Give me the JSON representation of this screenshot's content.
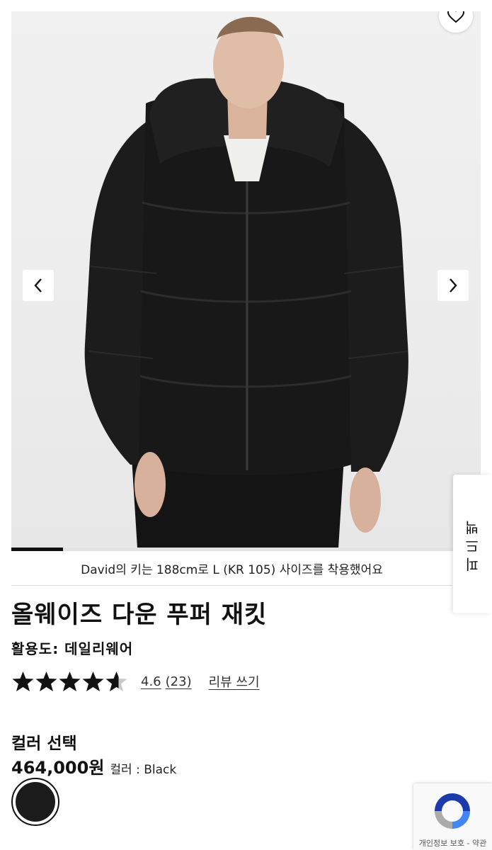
{
  "gallery": {
    "image_alt": "Black hooded puffer down jacket worn by model",
    "slide_progress": 0.11
  },
  "model_caption": "David의 키는 188cm로 L (KR 105) 사이즈를 착용했어요",
  "product": {
    "title": "올웨이즈 다운 푸퍼 재킷",
    "usage": "활용도: 데일리웨어",
    "rating": {
      "stars": 4.6,
      "value": "4.6",
      "count": "(23)",
      "write_review": "리뷰 쓰기"
    },
    "color_heading": "컬러 선택",
    "price": "464,000원",
    "color_label": "컬러 : Black",
    "swatch_color": "#1b1b1b"
  },
  "side_tab": {
    "label": "피드백"
  },
  "recaptcha": {
    "footer": "개인정보 보호 - 약관"
  },
  "icons": {
    "wishlist": "heart-icon",
    "prev": "chevron-left-icon",
    "next": "chevron-right-icon"
  }
}
